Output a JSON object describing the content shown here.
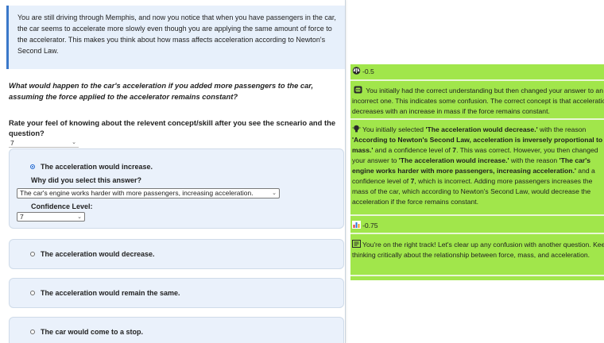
{
  "scenario": {
    "text": "You are still driving through Memphis, and now you notice that when you have passengers in the car, the car seems to accelerate more slowly even though you are applying the same amount of force to the accelerator. This makes you think about how mass affects acceleration according to Newton's Second Law."
  },
  "question": {
    "text": "What would happen to the car's acceleration if you added more passengers to the car, assuming the force applied to the accelerator remains constant?"
  },
  "fok": {
    "label": "Rate your feel of knowing about the relevent concept/skill after you see the scneario and the question?",
    "value": "7"
  },
  "options": [
    {
      "label": "The acceleration would increase.",
      "selected": true
    },
    {
      "label": "The acceleration would decrease.",
      "selected": false
    },
    {
      "label": "The acceleration would remain the same.",
      "selected": false
    },
    {
      "label": "The car would come to a stop.",
      "selected": false
    }
  ],
  "selected_option": {
    "why_label": "Why did you select this answer?",
    "reason_value": "The car's engine works harder with more passengers, increasing acceleration.",
    "confidence_label": "Confidence Level:",
    "confidence_value": "7"
  },
  "feedback": {
    "score1": "-0.5",
    "msg1_text": "You initially had the correct understanding but then changed your answer to an incorrect one. This indicates some confusion. The correct concept is that acceleration decreases with an increase in mass if the force remains constant.",
    "msg2": {
      "p1": "You initially selected ",
      "b1": "'The acceleration would decrease.'",
      "p2": " with the reason ",
      "b2": "'According to Newton's Second Law, acceleration is inversely proportional to mass.'",
      "p3": " and a confidence level of ",
      "b3": "7",
      "p4": ". This was correct. However, you then changed your answer to ",
      "b4": "'The acceleration would increase.'",
      "p5": " with the reason ",
      "b5": "'The car's engine works harder with more passengers, increasing acceleration.'",
      "p6": " and a confidence level of ",
      "b6": "7",
      "p7": ", which is incorrect. Adding more passengers increases the mass of the car, which according to Newton's Second Law, would decrease the acceleration if the force remains constant."
    },
    "score2": "-0.75",
    "msg3_text": "You're on the right track! Let's clear up any confusion with another question. Keep thinking critically about the relationship between force, mass, and acceleration."
  },
  "colors": {
    "feedback_bg": "#a1e64b",
    "card_bg": "#eaf1fb",
    "scenario_border": "#3a78c9",
    "radio_selected": "#1e66d0"
  },
  "icons": [
    "scale-icon",
    "robot-icon",
    "bulb-icon",
    "bar-chart-icon",
    "message-icon",
    "chevron-down-icon"
  ]
}
